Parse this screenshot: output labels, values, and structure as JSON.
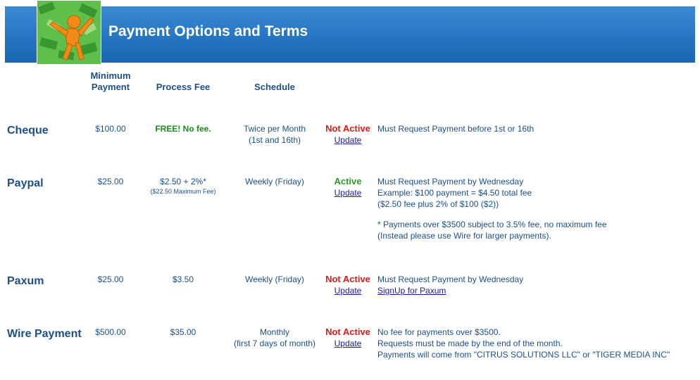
{
  "header": {
    "title": "Payment Options and Terms"
  },
  "columns": {
    "min_payment": "Minimum Payment",
    "process_fee": "Process Fee",
    "schedule": "Schedule"
  },
  "rows": [
    {
      "name": "Cheque",
      "min": "$100.00",
      "fee": "FREE! No fee.",
      "fee_note": "",
      "schedule_line1": "Twice per Month",
      "schedule_line2": "(1st and 16th)",
      "status": "Not Active",
      "status_color": "#e01818",
      "update": "Update",
      "notes": [
        "Must Request Payment before 1st or 16th"
      ]
    },
    {
      "name": "Paypal",
      "min": "$25.00",
      "fee": "$2.50 + 2%*",
      "fee_note": "($22.50 Maximum Fee)",
      "schedule_line1": "Weekly (Friday)",
      "schedule_line2": "",
      "status": "Active",
      "status_color": "#2a9a2a",
      "update": "Update",
      "notes": [
        "Must Request Payment by Wednesday",
        "Example: $100 payment = $4.50 total fee",
        "($2.50 fee plus 2% of $100 ($2))",
        "",
        "* Payments over $3500 subject to 3.5% fee, no maximum fee",
        "(Instead please use Wire for larger payments)."
      ]
    },
    {
      "name": "Paxum",
      "min": "$25.00",
      "fee": "$3.50",
      "fee_note": "",
      "schedule_line1": "Weekly (Friday)",
      "schedule_line2": "",
      "status": "Not Active",
      "status_color": "#e01818",
      "update": "Update",
      "notes": [
        "Must Request Payment by Wednesday"
      ],
      "link": "SignUp for Paxum"
    },
    {
      "name": "Wire Payment",
      "min": "$500.00",
      "fee": "$35.00",
      "fee_note": "",
      "schedule_line1": "Monthly",
      "schedule_line2": "(first 7 days of month)",
      "status": "Not Active",
      "status_color": "#e01818",
      "update": "Update",
      "notes": [
        "No fee for payments over $3500.",
        "Requests must be made by the end of the month.",
        "Payments will come from \"CITRUS SOLUTIONS LLC\" or \"TIGER MEDIA INC\""
      ]
    }
  ]
}
